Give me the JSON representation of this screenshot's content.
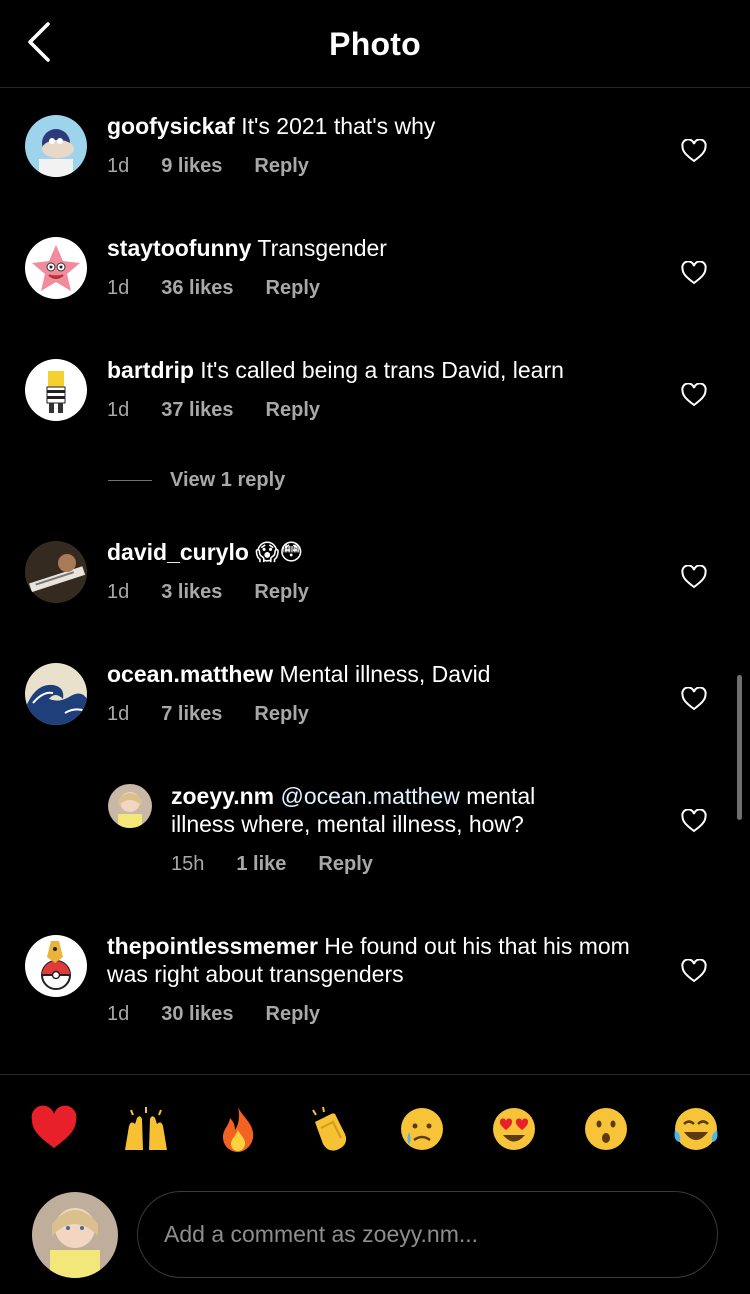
{
  "header": {
    "title": "Photo"
  },
  "comments": [
    {
      "user": "goofysickaf",
      "text": "It's 2021 that's why",
      "time": "1d",
      "likes": "9 likes",
      "reply": "Reply"
    },
    {
      "user": "staytoofunny",
      "text": "Transgender",
      "time": "1d",
      "likes": "36 likes",
      "reply": "Reply"
    },
    {
      "user": "bartdrip",
      "text": "It's called being a trans David, learn",
      "time": "1d",
      "likes": "37 likes",
      "reply": "Reply"
    },
    {
      "user": "david_curylo",
      "text": "😱😳",
      "time": "1d",
      "likes": "3 likes",
      "reply": "Reply"
    },
    {
      "user": "ocean.matthew",
      "text": "Mental illness, David",
      "time": "1d",
      "likes": "7 likes",
      "reply": "Reply"
    },
    {
      "user": "thepointlessmemer",
      "text": "He found out his that his mom was right about transgenders",
      "time": "1d",
      "likes": "30 likes",
      "reply": "Reply"
    }
  ],
  "view_replies": "View 1 reply",
  "reply_comment": {
    "user": "zoeyy.nm",
    "mention": "@ocean.matthew",
    "text": "mental illness where, mental illness, how?",
    "time": "15h",
    "likes": "1 like",
    "reply": "Reply"
  },
  "emoji_bar": [
    "red-heart",
    "raising-hands",
    "fire",
    "clapping-hands",
    "crying-face",
    "heart-eyes",
    "astonished-face",
    "tears-of-joy"
  ],
  "composer": {
    "placeholder": "Add a comment as zoeyy.nm..."
  },
  "colors": {
    "background": "#000000",
    "secondary_text": "#a8a8a8",
    "divider": "#262626"
  }
}
